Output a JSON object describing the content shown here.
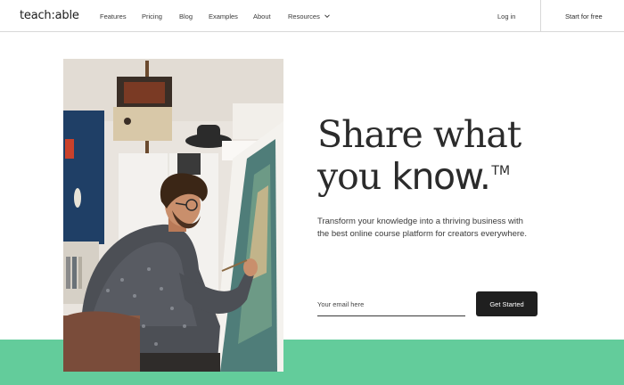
{
  "brand": {
    "logo_text": "teach:able"
  },
  "nav": {
    "links": [
      {
        "label": "Features"
      },
      {
        "label": "Pricing"
      },
      {
        "label": "Blog"
      },
      {
        "label": "Examples"
      },
      {
        "label": "About"
      },
      {
        "label": "Resources"
      }
    ],
    "login_label": "Log in",
    "start_free_label": "Start for free"
  },
  "hero": {
    "headline_line1": "Share what",
    "headline_line2_prefix": "you ",
    "headline_line2_emphasis": "know.",
    "trademark": "TM",
    "subtext": "Transform your knowledge into a thriving business with the best online course platform for creators everywhere.",
    "email_placeholder": "Your email here",
    "cta_label": "Get Started"
  },
  "colors": {
    "accent_green": "#63cc9b",
    "button_dark": "#1f1f1f"
  },
  "icons": {
    "resources_dropdown": "chevron-down-icon"
  }
}
